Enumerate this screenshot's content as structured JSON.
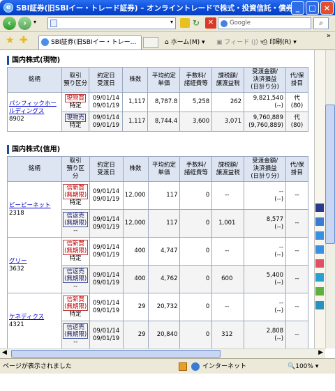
{
  "window": {
    "title": "SBI証券(旧SBIイー・トレード証券) – オンライントレードで株式・投資信託・債券を – Win...",
    "minimize": "_",
    "maximize": "□",
    "close": "×"
  },
  "address": {
    "url": "",
    "search_placeholder": "Google"
  },
  "toolbar": {
    "tab_label": "SBI証券(旧SBIイー・トレー...",
    "home": "ホーム(M)",
    "feed": "フィード (J)",
    "print": "印刷(R)",
    "more": "»"
  },
  "section1": {
    "title": "国内株式(現物)",
    "headers": [
      "銘柄",
      "取引\n預り区分",
      "約定日\n受渡日",
      "株数",
      "平均約定\n単価",
      "手数料/\n諸経費等",
      "課税額/\n譲渡益税",
      "受渡金額/\n決済損益\n(日計り分)",
      "代/保\n掛目"
    ],
    "stock": {
      "name": "パシフィックホールディングス",
      "code": "8902"
    },
    "rows": [
      {
        "type": "現物買",
        "deposit": "特定",
        "date1": "09/01/14",
        "date2": "09/01/19",
        "shares": "1,117",
        "price": "8,787.8",
        "fee": "5,258",
        "tax": "262",
        "amount": "9,821,540",
        "pl": "(--)",
        "dai": "代",
        "kakeme": "(80)"
      },
      {
        "type": "現物売",
        "deposit": "特定",
        "date1": "09/01/14",
        "date2": "09/01/19",
        "shares": "1,117",
        "price": "8,744.4",
        "fee": "3,600",
        "tax": "3,071",
        "amount": "9,760,889",
        "pl": "(9,760,889)",
        "dai": "代",
        "kakeme": "(80)"
      }
    ]
  },
  "section2": {
    "title": "国内株式(信用)",
    "headers": [
      "銘柄",
      "取引\n預り区\n分",
      "約定日\n受渡日",
      "株数",
      "平均約定\n単価",
      "手数料/\n諸経費等",
      "課税額/\n譲渡益税",
      "受渡金額/\n決済損益\n(日計り分)",
      "代/保\n掛目"
    ],
    "stocks": [
      {
        "name": "ビーピーネット",
        "code": "2318",
        "rows": [
          {
            "type": "信新買",
            "limit": "(無期限)",
            "deposit": "特定",
            "date1": "09/01/14",
            "date2": "09/01/19",
            "shares": "12,000",
            "price": "117",
            "fee": "0",
            "tax": "--",
            "amount": "--",
            "pl": "(--)",
            "kakeme": "--"
          },
          {
            "type": "信返売",
            "limit": "(無期限)",
            "deposit": "--",
            "date1": "09/01/14",
            "date2": "09/01/19",
            "shares": "12,000",
            "price": "117",
            "fee": "0",
            "tax": "1,001",
            "amount": "8,577",
            "pl": "(--)",
            "kakeme": "--"
          }
        ]
      },
      {
        "name": "グリー",
        "code": "3632",
        "rows": [
          {
            "type": "信新買",
            "limit": "(無期限)",
            "deposit": "特定",
            "date1": "09/01/14",
            "date2": "09/01/19",
            "shares": "400",
            "price": "4,747",
            "fee": "0",
            "tax": "--",
            "amount": "--",
            "pl": "(--)",
            "kakeme": "--"
          },
          {
            "type": "信返売",
            "limit": "(無期限)",
            "deposit": "--",
            "date1": "09/01/14",
            "date2": "09/01/19",
            "shares": "400",
            "price": "4,762",
            "fee": "0",
            "tax": "600",
            "amount": "5,400",
            "pl": "(--)",
            "kakeme": "--"
          }
        ]
      },
      {
        "name": "ケネディクス",
        "code": "4321",
        "rows": [
          {
            "type": "信新買",
            "limit": "(無期限)",
            "deposit": "特定",
            "date1": "09/01/14",
            "date2": "09/01/19",
            "shares": "29",
            "price": "20,732",
            "fee": "0",
            "tax": "--",
            "amount": "--",
            "pl": "(--)",
            "kakeme": "--"
          },
          {
            "type": "信返売",
            "limit": "(無期限)",
            "deposit": "--",
            "date1": "09/01/14",
            "date2": "09/01/19",
            "shares": "29",
            "price": "20,840",
            "fee": "0",
            "tax": "312",
            "amount": "2,808",
            "pl": "(--)",
            "kakeme": "--"
          }
        ]
      }
    ]
  },
  "status": {
    "text": "ページが表示されました",
    "zone": "インターネット",
    "zoom": "100%"
  }
}
